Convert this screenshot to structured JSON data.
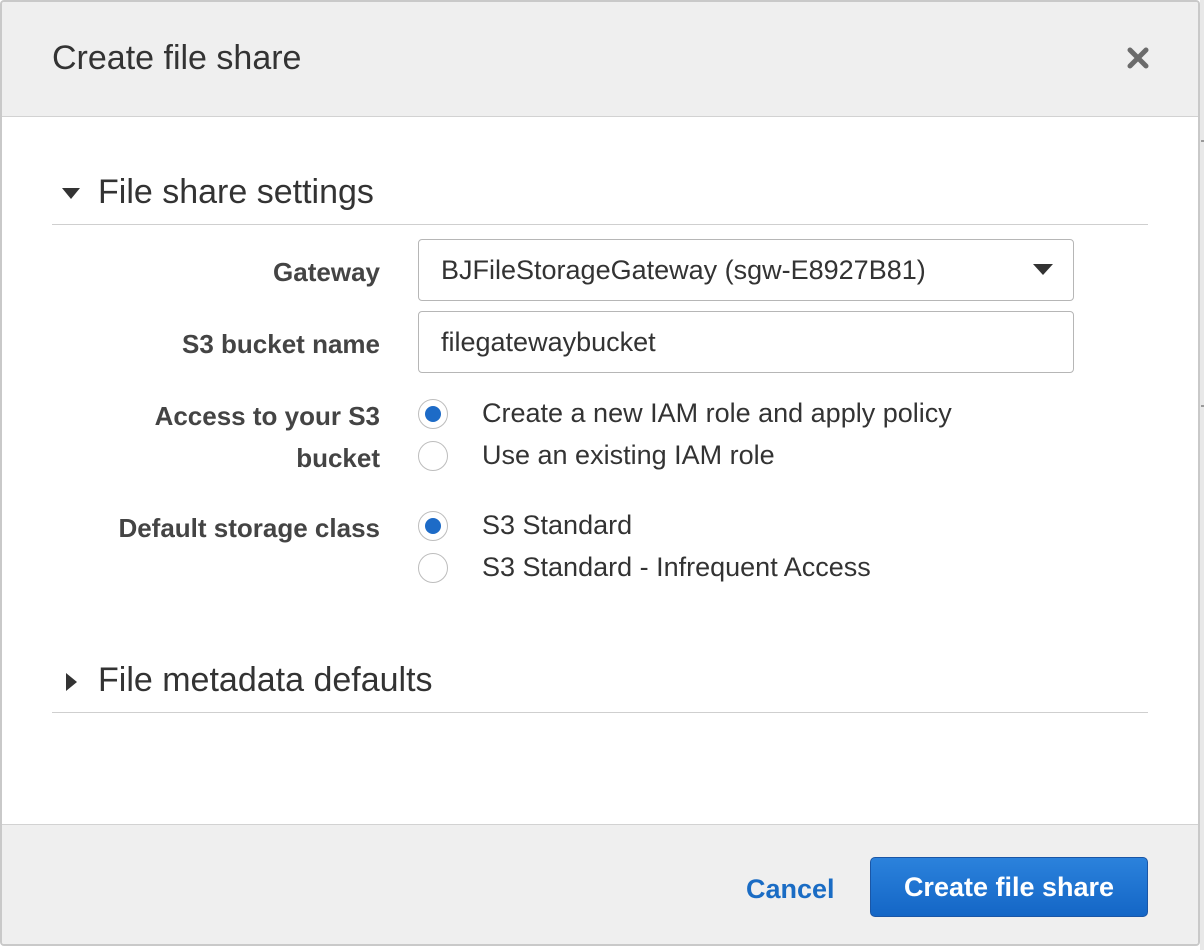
{
  "dialog": {
    "title": "Create file share",
    "close_icon": "close-icon"
  },
  "sections": {
    "settings": {
      "label": "File share settings",
      "expanded": true
    },
    "metadata": {
      "label": "File metadata defaults",
      "expanded": false
    }
  },
  "form": {
    "gateway": {
      "label": "Gateway",
      "selected": "BJFileStorageGateway (sgw-E8927B81)"
    },
    "bucket": {
      "label": "S3 bucket name",
      "value": "filegatewaybucket"
    },
    "access": {
      "label_line1": "Access to your S3",
      "label_line2": "bucket",
      "options": [
        {
          "label": "Create a new IAM role and apply policy",
          "checked": true
        },
        {
          "label": "Use an existing IAM role",
          "checked": false
        }
      ]
    },
    "storage_class": {
      "label": "Default storage class",
      "options": [
        {
          "label": "S3 Standard",
          "checked": true
        },
        {
          "label": "S3 Standard - Infrequent Access",
          "checked": false
        }
      ]
    }
  },
  "footer": {
    "cancel_label": "Cancel",
    "create_label": "Create file share"
  },
  "colors": {
    "accent": "#1d6bc7",
    "link": "#1a6cc4",
    "header_bg": "#efefef"
  }
}
